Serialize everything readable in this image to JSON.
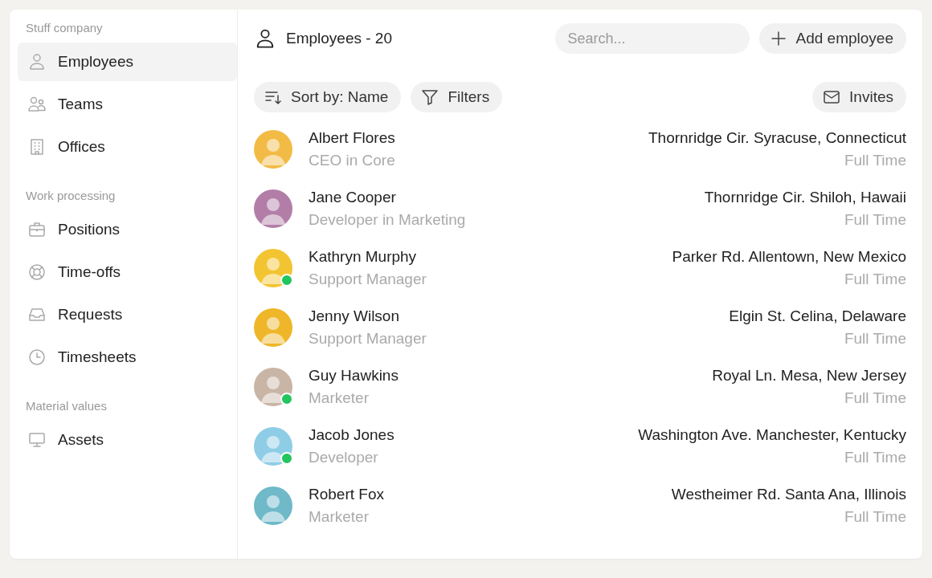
{
  "sidebar": {
    "sections": [
      {
        "title": "Stuff company",
        "items": [
          {
            "label": "Employees",
            "kind": "person",
            "selected": true
          },
          {
            "label": "Teams",
            "kind": "people",
            "selected": false
          },
          {
            "label": "Offices",
            "kind": "building",
            "selected": false
          }
        ]
      },
      {
        "title": "Work processing",
        "items": [
          {
            "label": "Positions",
            "kind": "briefcase",
            "selected": false
          },
          {
            "label": "Time-offs",
            "kind": "lifebuoy",
            "selected": false
          },
          {
            "label": "Requests",
            "kind": "inbox",
            "selected": false
          },
          {
            "label": "Timesheets",
            "kind": "clock",
            "selected": false
          }
        ]
      },
      {
        "title": "Material values",
        "items": [
          {
            "label": "Assets",
            "kind": "monitor",
            "selected": false
          }
        ]
      }
    ]
  },
  "header": {
    "title": "Employees - 20",
    "search": {
      "placeholder": "Search..."
    },
    "add_button": "Add employee"
  },
  "toolbar": {
    "sort_label": "Sort by:",
    "sort_value": "Name",
    "filters": "Filters",
    "invites": "Invites"
  },
  "employees": [
    {
      "name": "Albert Flores",
      "role": "CEO in Core",
      "address": "Thornridge Cir. Syracuse, Connecticut",
      "type": "Full Time",
      "color": "#f2bb45",
      "online": false
    },
    {
      "name": "Jane Cooper",
      "role": "Developer in Marketing",
      "address": "Thornridge Cir. Shiloh, Hawaii",
      "type": "Full Time",
      "color": "#b27ea8",
      "online": false
    },
    {
      "name": "Kathryn Murphy",
      "role": "Support Manager",
      "address": "Parker Rd. Allentown, New Mexico",
      "type": "Full Time",
      "color": "#f3c431",
      "online": true
    },
    {
      "name": "Jenny Wilson",
      "role": "Support Manager",
      "address": "Elgin St. Celina, Delaware",
      "type": "Full Time",
      "color": "#eeb628",
      "online": false
    },
    {
      "name": "Guy Hawkins",
      "role": "Marketer",
      "address": "Royal Ln. Mesa, New Jersey",
      "type": "Full Time",
      "color": "#c9b5a6",
      "online": true
    },
    {
      "name": "Jacob Jones",
      "role": "Developer",
      "address": "Washington Ave. Manchester, Kentucky",
      "type": "Full Time",
      "color": "#8fcde6",
      "online": true
    },
    {
      "name": "Robert Fox",
      "role": "Marketer",
      "address": "Westheimer Rd. Santa Ana, Illinois",
      "type": "Full Time",
      "color": "#6fb9c9",
      "online": false
    }
  ]
}
